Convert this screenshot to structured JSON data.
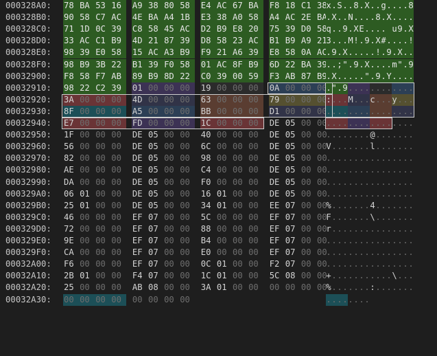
{
  "app": {
    "name": "hex-editor"
  },
  "rows": [
    {
      "addr": "000328A0:",
      "hex": [
        "78",
        "BA",
        "53",
        "16",
        "A9",
        "38",
        "80",
        "58",
        "E4",
        "AC",
        "67",
        "BA",
        "F8",
        "18",
        "C1",
        "38"
      ],
      "ascii": "x.S..8.X..g....8"
    },
    {
      "addr": "000328B0:",
      "hex": [
        "90",
        "58",
        "C7",
        "AC",
        "4E",
        "BA",
        "A4",
        "1B",
        "E3",
        "38",
        "A0",
        "58",
        "A4",
        "AC",
        "2E",
        "BA"
      ],
      "ascii": ".X..N....8.X...."
    },
    {
      "addr": "000328C0:",
      "hex": [
        "71",
        "1D",
        "0C",
        "39",
        "C8",
        "58",
        "45",
        "AC",
        "D2",
        "B9",
        "E8",
        "20",
        "75",
        "39",
        "D0",
        "58"
      ],
      "ascii": "q..9.XE.... u9.X"
    },
    {
      "addr": "000328D0:",
      "hex": [
        "33",
        "AC",
        "C1",
        "B9",
        "4D",
        "21",
        "87",
        "39",
        "D8",
        "58",
        "23",
        "AC",
        "B1",
        "B9",
        "A9",
        "21"
      ],
      "ascii": "3...M!.9.X#....!"
    },
    {
      "addr": "000328E0:",
      "hex": [
        "98",
        "39",
        "E0",
        "58",
        "15",
        "AC",
        "A3",
        "B9",
        "F9",
        "21",
        "A6",
        "39",
        "E8",
        "58",
        "0A",
        "AC"
      ],
      "ascii": ".9.X.....!.9.X.."
    },
    {
      "addr": "000328F0:",
      "hex": [
        "98",
        "B9",
        "3B",
        "22",
        "B1",
        "39",
        "F0",
        "58",
        "01",
        "AC",
        "8F",
        "B9",
        "6D",
        "22",
        "BA",
        "39"
      ],
      "ascii": "..;\".9.X....m\".9"
    },
    {
      "addr": "00032900:",
      "hex": [
        "F8",
        "58",
        "F7",
        "AB",
        "89",
        "B9",
        "8D",
        "22",
        "C0",
        "39",
        "00",
        "59",
        "F3",
        "AB",
        "87",
        "B9"
      ],
      "ascii": ".X.....\".9.Y...."
    },
    {
      "addr": "00032910:",
      "hex": [
        "98",
        "22",
        "C2",
        "39",
        "01",
        "00",
        "00",
        "00",
        "19",
        "00",
        "00",
        "00",
        "0A",
        "00",
        "00",
        "00"
      ],
      "ascii": ".\".9............"
    },
    {
      "addr": "00032920:",
      "hex": [
        "3A",
        "00",
        "00",
        "00",
        "4D",
        "00",
        "00",
        "00",
        "63",
        "00",
        "00",
        "00",
        "79",
        "00",
        "00",
        "00"
      ],
      "ascii": ":...M...c...y..."
    },
    {
      "addr": "00032930:",
      "hex": [
        "8F",
        "00",
        "00",
        "00",
        "A5",
        "00",
        "00",
        "00",
        "BB",
        "00",
        "00",
        "00",
        "D1",
        "00",
        "00",
        "00"
      ],
      "ascii": "................"
    },
    {
      "addr": "00032940:",
      "hex": [
        "E7",
        "00",
        "00",
        "00",
        "FD",
        "00",
        "00",
        "00",
        "1C",
        "00",
        "00",
        "00",
        "DE",
        "05",
        "00",
        "00"
      ],
      "ascii": "................"
    },
    {
      "addr": "00032950:",
      "hex": [
        "1F",
        "00",
        "00",
        "00",
        "DE",
        "05",
        "00",
        "00",
        "40",
        "00",
        "00",
        "00",
        "DE",
        "05",
        "00",
        "00"
      ],
      "ascii": "........@......."
    },
    {
      "addr": "00032960:",
      "hex": [
        "56",
        "00",
        "00",
        "00",
        "DE",
        "05",
        "00",
        "00",
        "6C",
        "00",
        "00",
        "00",
        "DE",
        "05",
        "00",
        "00"
      ],
      "ascii": "V.......l......."
    },
    {
      "addr": "00032970:",
      "hex": [
        "82",
        "00",
        "00",
        "00",
        "DE",
        "05",
        "00",
        "00",
        "98",
        "00",
        "00",
        "00",
        "DE",
        "05",
        "00",
        "00"
      ],
      "ascii": "................"
    },
    {
      "addr": "00032980:",
      "hex": [
        "AE",
        "00",
        "00",
        "00",
        "DE",
        "05",
        "00",
        "00",
        "C4",
        "00",
        "00",
        "00",
        "DE",
        "05",
        "00",
        "00"
      ],
      "ascii": "................"
    },
    {
      "addr": "00032990:",
      "hex": [
        "DA",
        "00",
        "00",
        "00",
        "DE",
        "05",
        "00",
        "00",
        "F0",
        "00",
        "00",
        "00",
        "DE",
        "05",
        "00",
        "00"
      ],
      "ascii": "................"
    },
    {
      "addr": "000329A0:",
      "hex": [
        "06",
        "01",
        "00",
        "00",
        "DE",
        "05",
        "00",
        "00",
        "16",
        "01",
        "00",
        "00",
        "DE",
        "05",
        "00",
        "00"
      ],
      "ascii": "................"
    },
    {
      "addr": "000329B0:",
      "hex": [
        "25",
        "01",
        "00",
        "00",
        "DE",
        "05",
        "00",
        "00",
        "34",
        "01",
        "00",
        "00",
        "EE",
        "07",
        "00",
        "00"
      ],
      "ascii": "%.......4......."
    },
    {
      "addr": "000329C0:",
      "hex": [
        "46",
        "00",
        "00",
        "00",
        "EF",
        "07",
        "00",
        "00",
        "5C",
        "00",
        "00",
        "00",
        "EF",
        "07",
        "00",
        "00"
      ],
      "ascii": "F.......\\......."
    },
    {
      "addr": "000329D0:",
      "hex": [
        "72",
        "00",
        "00",
        "00",
        "EF",
        "07",
        "00",
        "00",
        "88",
        "00",
        "00",
        "00",
        "EF",
        "07",
        "00",
        "00"
      ],
      "ascii": "r..............."
    },
    {
      "addr": "000329E0:",
      "hex": [
        "9E",
        "00",
        "00",
        "00",
        "EF",
        "07",
        "00",
        "00",
        "B4",
        "00",
        "00",
        "00",
        "EF",
        "07",
        "00",
        "00"
      ],
      "ascii": "................"
    },
    {
      "addr": "000329F0:",
      "hex": [
        "CA",
        "00",
        "00",
        "00",
        "EF",
        "07",
        "00",
        "00",
        "E0",
        "00",
        "00",
        "00",
        "EF",
        "07",
        "00",
        "00"
      ],
      "ascii": "................"
    },
    {
      "addr": "00032A00:",
      "hex": [
        "F6",
        "00",
        "00",
        "00",
        "EF",
        "07",
        "00",
        "00",
        "0C",
        "01",
        "00",
        "00",
        "F2",
        "07",
        "00",
        "00"
      ],
      "ascii": "................"
    },
    {
      "addr": "00032A10:",
      "hex": [
        "2B",
        "01",
        "00",
        "00",
        "F4",
        "07",
        "00",
        "00",
        "1C",
        "01",
        "00",
        "00",
        "5C",
        "08",
        "00",
        "00"
      ],
      "ascii": "+...........\\..."
    },
    {
      "addr": "00032A20:",
      "hex": [
        "25",
        "00",
        "00",
        "00",
        "AB",
        "08",
        "00",
        "00",
        "3A",
        "01",
        "00",
        "00",
        "00",
        "00",
        "00",
        "00"
      ],
      "ascii": "%.......:......."
    },
    {
      "addr": "00032A30:",
      "hex": [
        "00",
        "00",
        "00",
        "00",
        "00",
        "00",
        "00",
        "00"
      ],
      "ascii": "........"
    }
  ],
  "colors": {
    "background": "#1e1e1e",
    "address": "#c8c8c8",
    "zero_byte": "#6e6e6e",
    "header_highlight": "#2d5b22",
    "selection_border": "#cfcfcf"
  }
}
